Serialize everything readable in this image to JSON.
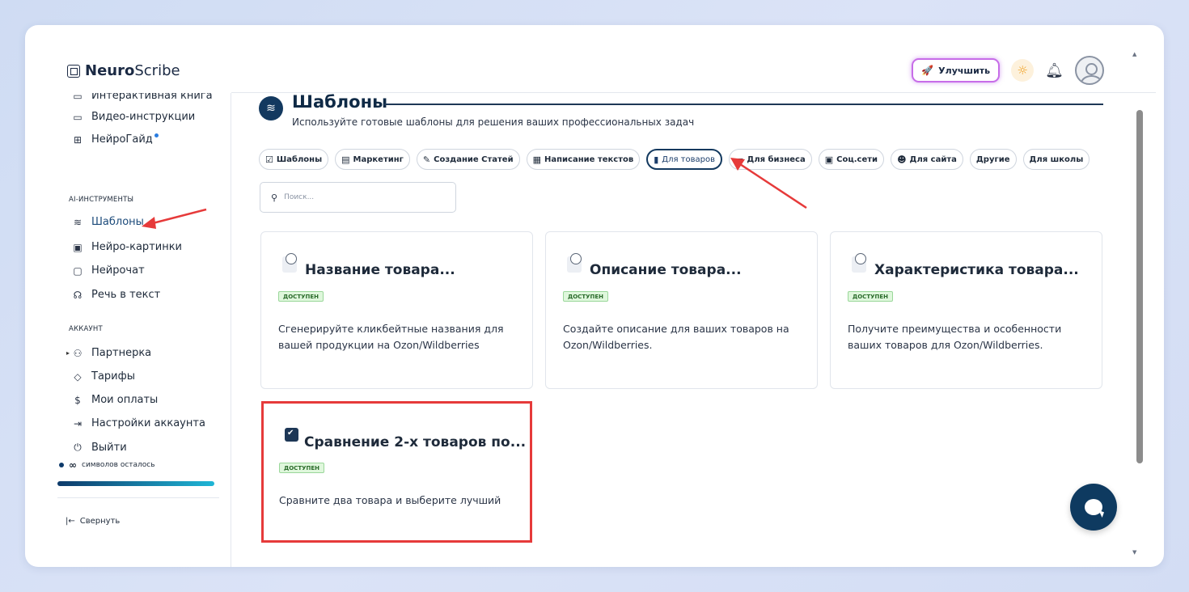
{
  "header": {
    "logo_bold": "Neuro",
    "logo_rest": "Scribe",
    "upgrade_label": "Улучшить"
  },
  "sidebar": {
    "top_items": [
      {
        "label": "Интерактивная книга",
        "icon": "book-icon"
      },
      {
        "label": "Видео-инструкции",
        "icon": "video-icon"
      },
      {
        "label": "НейроГайд",
        "icon": "guide-icon"
      }
    ],
    "section_ai": "AI-ИНСТРУМЕНТЫ",
    "ai_items": [
      {
        "label": "Шаблоны",
        "icon": "layers-icon"
      },
      {
        "label": "Нейро-картинки",
        "icon": "image-icon"
      },
      {
        "label": "Нейрочат",
        "icon": "chat-icon"
      },
      {
        "label": "Речь в текст",
        "icon": "headphones-icon"
      }
    ],
    "section_account": "АККАУНТ",
    "account_items": [
      {
        "label": "Партнерка",
        "icon": "users-icon"
      },
      {
        "label": "Тарифы",
        "icon": "tag-icon"
      },
      {
        "label": "Мои оплаты",
        "icon": "dollar-icon"
      },
      {
        "label": "Настройки аккаунта",
        "icon": "login-icon"
      },
      {
        "label": "Выйти",
        "icon": "power-icon"
      }
    ],
    "credits_symbol": "∞",
    "credits_label": "символов осталось",
    "collapse_label": "Свернуть"
  },
  "main": {
    "title": "Шаблоны",
    "subtitle": "Используйте готовые шаблоны для решения ваших профессиональных задач",
    "tabs": [
      {
        "label": "Шаблоны",
        "icon": "☑"
      },
      {
        "label": "Маркетинг",
        "icon": "▤"
      },
      {
        "label": "Создание Статей",
        "icon": "✎"
      },
      {
        "label": "Написание текстов",
        "icon": "▦"
      },
      {
        "label": "Для товаров",
        "icon": "▮"
      },
      {
        "label": "Для бизнеса",
        "icon": "▬"
      },
      {
        "label": "Соц.сети",
        "icon": "▣"
      },
      {
        "label": "Для сайта",
        "icon": "☻"
      },
      {
        "label": "Другие",
        "icon": ""
      },
      {
        "label": "Для школы",
        "icon": ""
      }
    ],
    "active_tab": "Для товаров",
    "search_placeholder": "Поиск...",
    "cards": [
      {
        "title": "Название товара...",
        "badge": "ДОСТУПЕН",
        "desc": "Сгенерируйте кликбейтные названия для вашей продукции на Ozon/Wildberries"
      },
      {
        "title": "Описание товара...",
        "badge": "ДОСТУПЕН",
        "desc": "Создайте описание для ваших товаров на Ozon/Wildberries."
      },
      {
        "title": "Характеристика товара...",
        "badge": "ДОСТУПЕН",
        "desc": "Получите преимущества и особенности ваших товаров для Ozon/Wildberries."
      },
      {
        "title": "Сравнение 2-х товаров по...",
        "badge": "ДОСТУПЕН",
        "desc": "Сравните два товара и выберите лучший"
      }
    ]
  },
  "colors": {
    "accent": "#13395f",
    "highlight": "#e63a3a",
    "badge_bg": "#dff7dc"
  }
}
